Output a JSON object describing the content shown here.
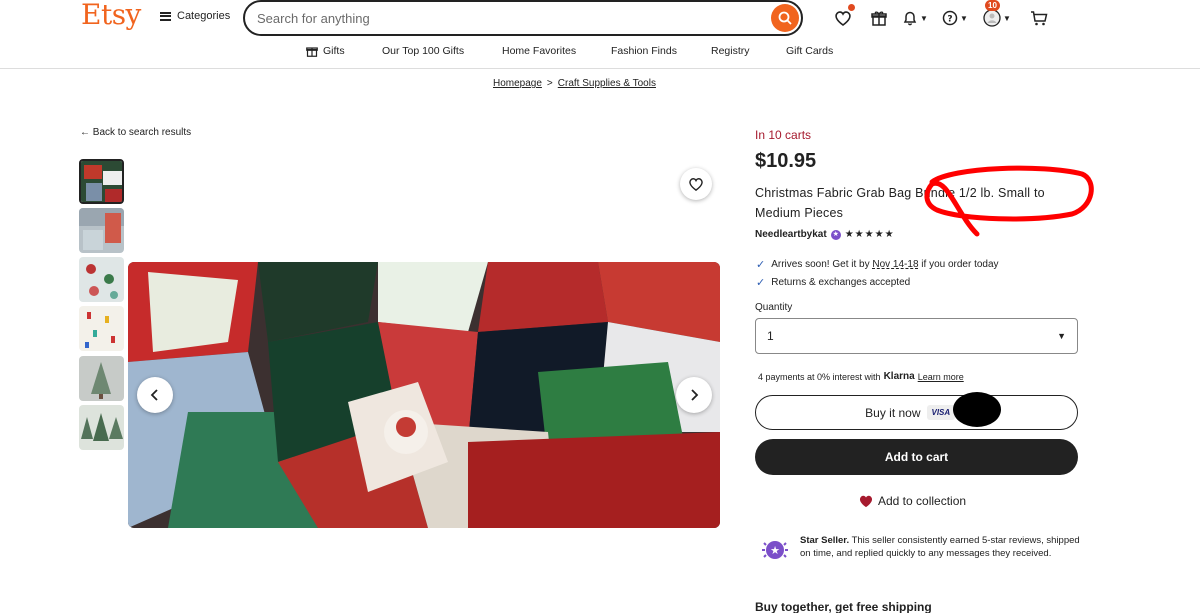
{
  "header": {
    "logo": "Etsy",
    "categories_label": "Categories",
    "search_placeholder": "Search for anything",
    "notifications_badge": "10"
  },
  "nav": {
    "items": [
      "Gifts",
      "Our Top 100 Gifts",
      "Home Favorites",
      "Fashion Finds",
      "Registry",
      "Gift Cards"
    ]
  },
  "breadcrumb": {
    "items": [
      "Homepage",
      "Craft Supplies & Tools"
    ],
    "separator": ">"
  },
  "back_link": "Back to search results",
  "product": {
    "in_carts": "In 10 carts",
    "price": "$10.95",
    "title": "Christmas Fabric Grab Bag Bundle 1/2 lb. Small to Medium Pieces",
    "seller_name": "Needleartbykat",
    "rating_stars": "★★★★★",
    "shipping_prefix": "Arrives soon! Get it by ",
    "shipping_date": "Nov 14-18",
    "shipping_suffix": " if you order today",
    "returns": "Returns & exchanges accepted",
    "quantity_label": "Quantity",
    "quantity_value": "1",
    "klarna_text": "4 payments at 0% interest with",
    "klarna_brand": "Klarna",
    "klarna_link": "Learn more",
    "buy_now": "Buy it now",
    "visa": "VISA",
    "buy_now_suffix": "..",
    "add_to_cart": "Add to cart",
    "add_to_collection": "Add to collection",
    "star_seller_title": "Star Seller.",
    "star_seller_text": " This seller consistently earned 5-star reviews, shipped on time, and replied quickly to any messages they received.",
    "bundle_heading": "Buy together, get free shipping"
  },
  "colors": {
    "brand": "#f1641e",
    "in_carts": "#a61a2e",
    "annotation": "#ff0000"
  }
}
